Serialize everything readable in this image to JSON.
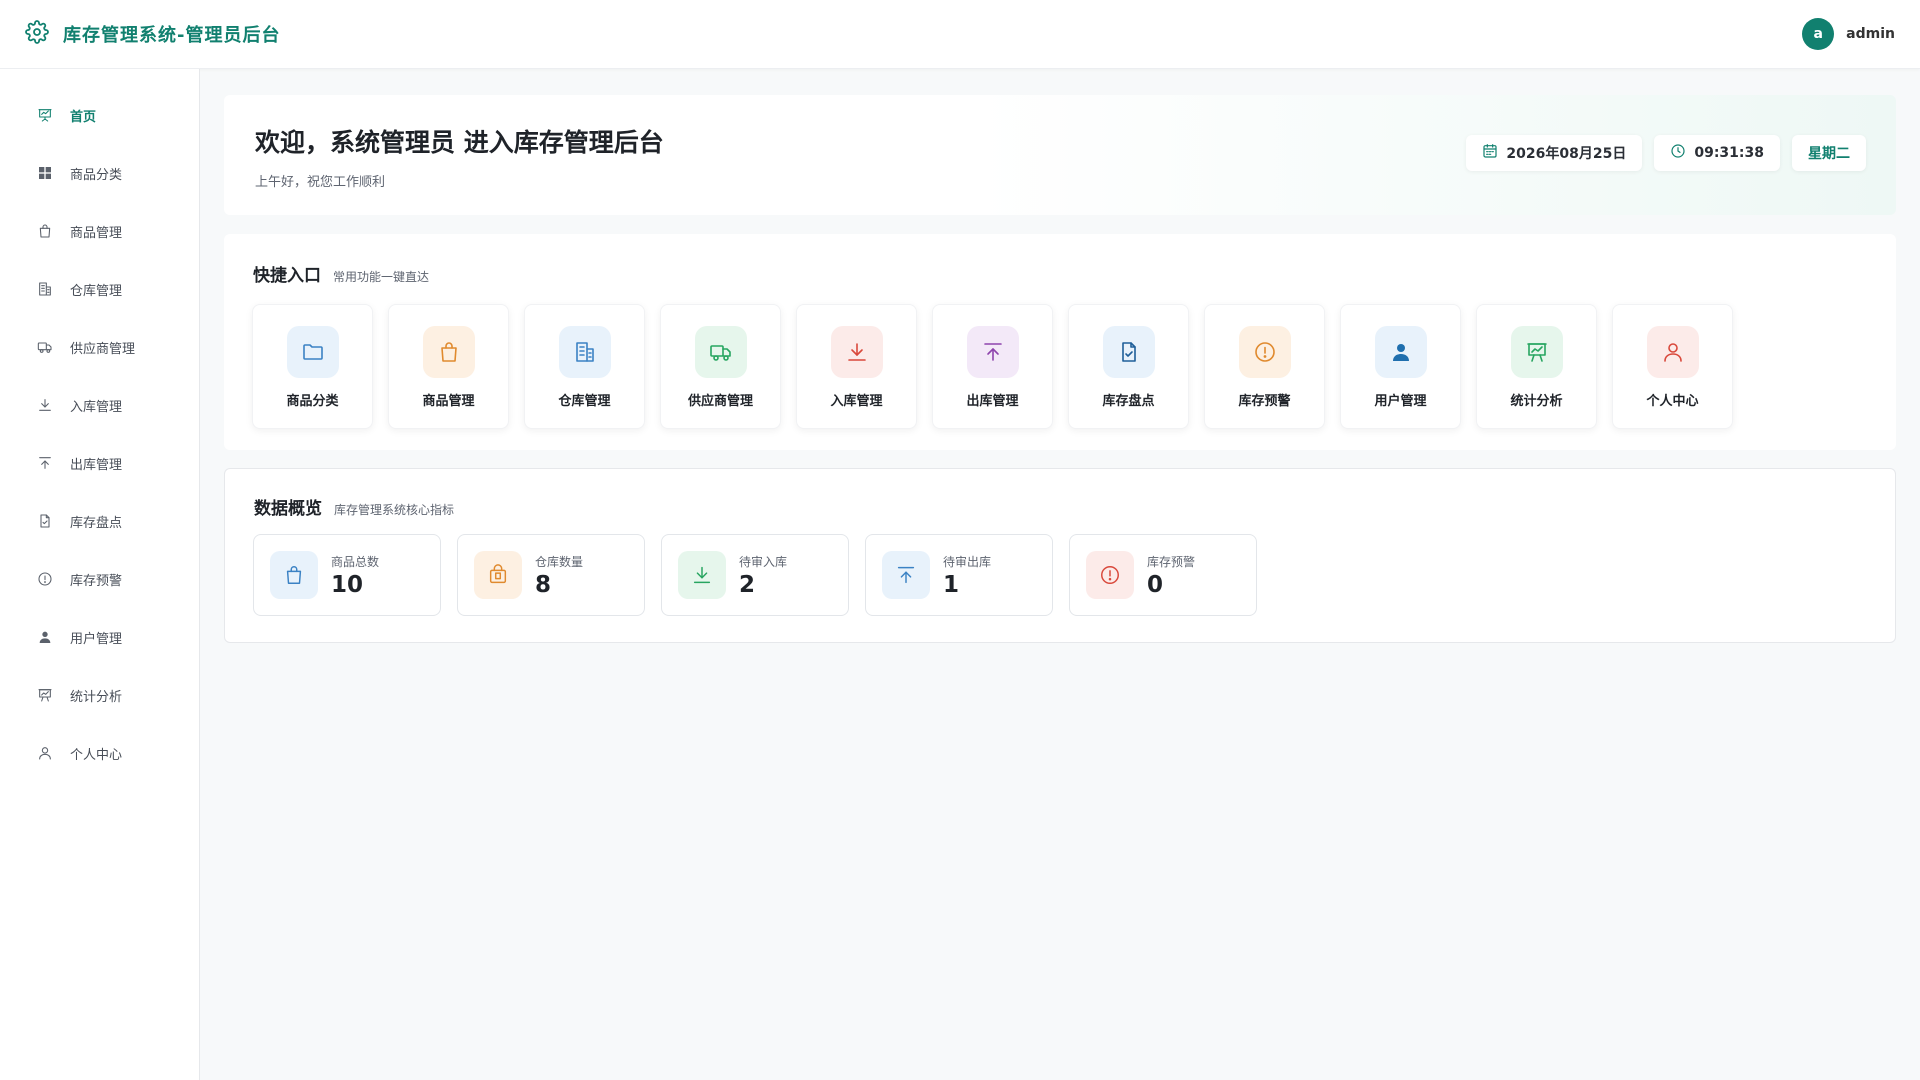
{
  "header": {
    "title": "库存管理系统-管理员后台",
    "avatar_letter": "a",
    "username": "admin",
    "accent": "#11806f"
  },
  "sidebar": {
    "items": [
      {
        "label": "首页",
        "icon": "dashboard-icon",
        "active": true
      },
      {
        "label": "商品分类",
        "icon": "grid-icon"
      },
      {
        "label": "商品管理",
        "icon": "shopping-bag-icon"
      },
      {
        "label": "仓库管理",
        "icon": "building-icon"
      },
      {
        "label": "供应商管理",
        "icon": "truck-icon"
      },
      {
        "label": "入库管理",
        "icon": "download-icon"
      },
      {
        "label": "出库管理",
        "icon": "upload-icon"
      },
      {
        "label": "库存盘点",
        "icon": "file-check-icon"
      },
      {
        "label": "库存预警",
        "icon": "alert-circle-icon"
      },
      {
        "label": "用户管理",
        "icon": "user-filled-icon"
      },
      {
        "label": "统计分析",
        "icon": "presentation-icon"
      },
      {
        "label": "个人中心",
        "icon": "user-icon"
      }
    ]
  },
  "welcome": {
    "title": "欢迎，系统管理员 进入库存管理后台",
    "subtitle": "上午好，祝您工作顺利",
    "date": "2026年08月25日",
    "time": "09:31:38",
    "weekday": "星期二"
  },
  "quick": {
    "title": "快捷入口",
    "desc": "常用功能一键直达",
    "items": [
      {
        "label": "商品分类",
        "icon": "folder-icon",
        "color": "#3b82c4",
        "bg": "#e8f2fb"
      },
      {
        "label": "商品管理",
        "icon": "shopping-bag-icon",
        "color": "#e08a2e",
        "bg": "#fdf0e2"
      },
      {
        "label": "仓库管理",
        "icon": "building-icon",
        "color": "#3b82c4",
        "bg": "#e8f2fb"
      },
      {
        "label": "供应商管理",
        "icon": "truck-icon",
        "color": "#27a560",
        "bg": "#e6f6ec"
      },
      {
        "label": "入库管理",
        "icon": "download-icon",
        "color": "#d9483b",
        "bg": "#fcebe9"
      },
      {
        "label": "出库管理",
        "icon": "upload-icon",
        "color": "#8e44ad",
        "bg": "#f3e9f8"
      },
      {
        "label": "库存盘点",
        "icon": "file-check-icon",
        "color": "#1f5f99",
        "bg": "#e8f2fb"
      },
      {
        "label": "库存预警",
        "icon": "alert-circle-icon",
        "color": "#e08a2e",
        "bg": "#fdf0e2"
      },
      {
        "label": "用户管理",
        "icon": "user-filled-icon",
        "color": "#1f6fae",
        "bg": "#e8f2fb"
      },
      {
        "label": "统计分析",
        "icon": "presentation-icon",
        "color": "#27a560",
        "bg": "#e6f6ec"
      },
      {
        "label": "个人中心",
        "icon": "user-icon",
        "color": "#d9483b",
        "bg": "#fcebe9"
      }
    ]
  },
  "overview": {
    "title": "数据概览",
    "desc": "库存管理系统核心指标",
    "stats": [
      {
        "label": "商品总数",
        "value": "10",
        "icon": "shopping-bag-icon",
        "color": "#3b82c4",
        "bg": "#e8f2fb"
      },
      {
        "label": "仓库数量",
        "value": "8",
        "icon": "package-icon",
        "color": "#e08a2e",
        "bg": "#fdf0e2"
      },
      {
        "label": "待审入库",
        "value": "2",
        "icon": "download-icon",
        "color": "#27a560",
        "bg": "#e6f6ec"
      },
      {
        "label": "待审出库",
        "value": "1",
        "icon": "upload-icon",
        "color": "#3b82c4",
        "bg": "#e8f2fb"
      },
      {
        "label": "库存预警",
        "value": "0",
        "icon": "alert-circle-icon",
        "color": "#d9483b",
        "bg": "#fcebe9"
      }
    ]
  }
}
